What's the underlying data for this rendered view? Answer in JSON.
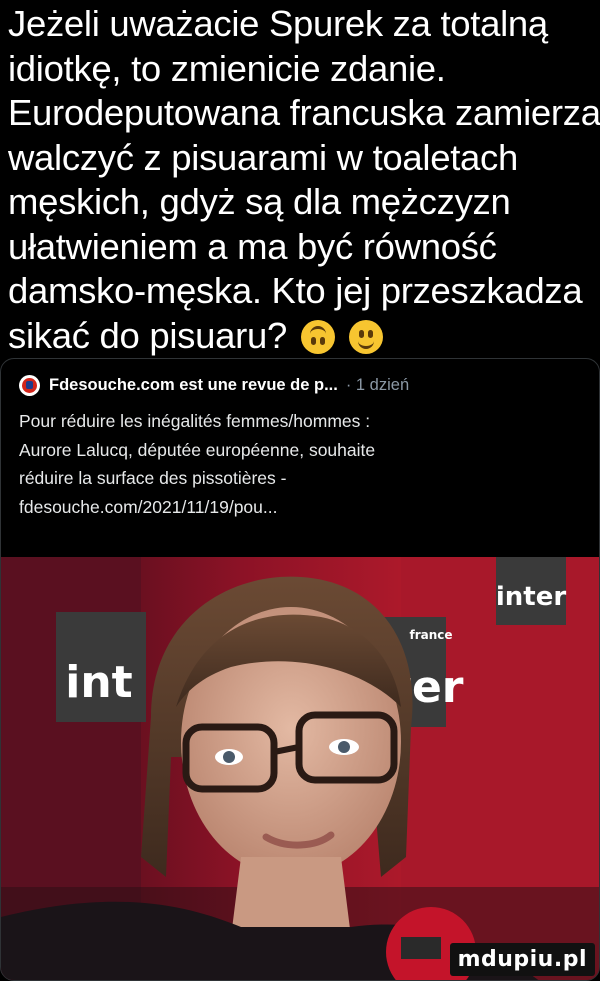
{
  "caption": {
    "lines": [
      "Jeżeli uważacie Spurek za totalną",
      "idiotkę, to zmienicie zdanie.",
      "Eurodeputowana francuska zamierza",
      "walczyć z pisuarami w toaletach",
      "męskich, gdyż są dla mężczyzn",
      "ułatwieniem a ma być równość",
      "damsko-męska. Kto jej przeszkadza",
      "sikać do pisuaru?"
    ],
    "emojis": [
      "upside-down-face-icon",
      "smiling-face-icon"
    ]
  },
  "link_card": {
    "source": "Fdesouche.com est une revue de p...",
    "time": "· 1 dzień",
    "description_lines": [
      "Pour réduire les inégalités femmes/hommes :",
      "Aurore Lalucq, députée européenne, souhaite",
      "réduire la surface des pissotières -",
      "fdesouche.com/2021/11/19/pou..."
    ],
    "image_logos": [
      "inter",
      "int",
      "inter",
      "france",
      "inter"
    ]
  },
  "watermark": "mdupiu.pl",
  "colors": {
    "background": "#000000",
    "text": "#ffffff",
    "muted": "#8b98a5",
    "card_border": "#2f3336",
    "photo_red": "#b01a2b"
  }
}
